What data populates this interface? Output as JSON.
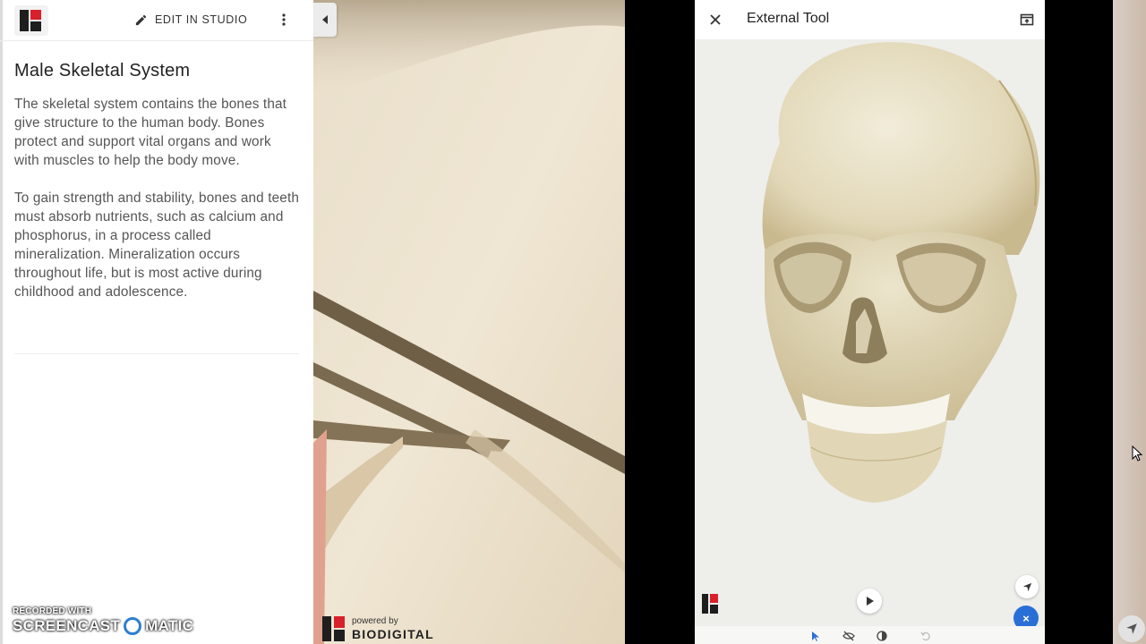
{
  "left_panel": {
    "edit_in_studio": "EDIT IN STUDIO",
    "title": "Male Skeletal System",
    "paragraphs": [
      "The skeletal system contains the bones that give structure to the human body. Bones protect and support vital organs and work with muscles to help the body move.",
      "To gain strength and stability, bones and teeth must absorb nutrients, such as calcium and phosphorus, in a process called mineralization. Mineralization occurs throughout life, but is most active during childhood and adolescence."
    ]
  },
  "watermark": {
    "line1": "RECORDED WITH",
    "line2a": "SCREENCAST",
    "line2b": "MATIC"
  },
  "viewer": {
    "powered_by": "powered by",
    "brand": "BIODIGITAL"
  },
  "external_tool": {
    "title": "External Tool",
    "close_button_label": "×",
    "accent_color": "#2a6fd6"
  },
  "colors": {
    "brand_red": "#d8202a",
    "bone": "#e9e2cc"
  }
}
